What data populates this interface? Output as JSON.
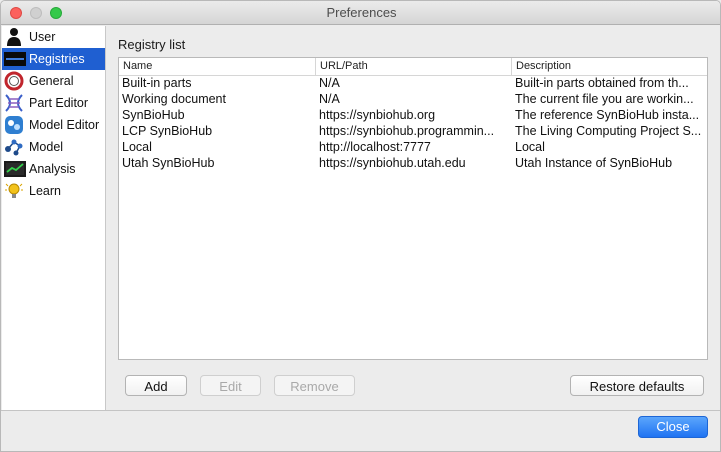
{
  "window": {
    "title": "Preferences"
  },
  "sidebar": {
    "items": [
      {
        "label": "User",
        "icon": "user-icon",
        "selected": false
      },
      {
        "label": "Registries",
        "icon": "registries-icon",
        "selected": true
      },
      {
        "label": "General",
        "icon": "general-icon",
        "selected": false
      },
      {
        "label": "Part Editor",
        "icon": "part-editor-icon",
        "selected": false
      },
      {
        "label": "Model Editor",
        "icon": "model-editor-icon",
        "selected": false
      },
      {
        "label": "Model",
        "icon": "model-icon",
        "selected": false
      },
      {
        "label": "Analysis",
        "icon": "analysis-icon",
        "selected": false
      },
      {
        "label": "Learn",
        "icon": "learn-icon",
        "selected": false
      }
    ]
  },
  "main": {
    "section_label": "Registry list",
    "table": {
      "columns": [
        "Name",
        "URL/Path",
        "Description"
      ],
      "rows": [
        [
          "Built-in parts",
          "N/A",
          "Built-in parts obtained from th..."
        ],
        [
          "Working document",
          "N/A",
          "The current file you are workin..."
        ],
        [
          "SynBioHub",
          "https://synbiohub.org",
          "The reference SynBioHub insta..."
        ],
        [
          "LCP SynBioHub",
          "https://synbiohub.programmin...",
          "The Living Computing Project S..."
        ],
        [
          "Local",
          "http://localhost:7777",
          "Local"
        ],
        [
          "Utah SynBioHub",
          "https://synbiohub.utah.edu",
          "Utah Instance of SynBioHub"
        ]
      ]
    },
    "buttons": {
      "add": "Add",
      "edit": "Edit",
      "remove": "Remove",
      "restore_defaults": "Restore defaults"
    }
  },
  "footer": {
    "close": "Close"
  },
  "colors": {
    "selection": "#1f5fd1",
    "close_button": "#1f73f2"
  }
}
